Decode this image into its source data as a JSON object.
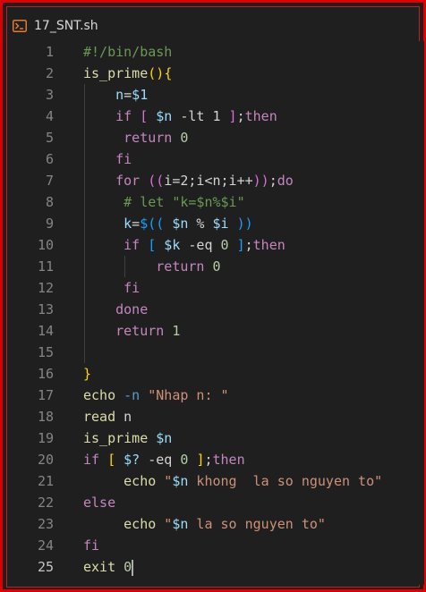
{
  "tab": {
    "icon": "terminal-icon",
    "title": "17_SNT.sh"
  },
  "colors": {
    "frame": "#e00000",
    "background": "#1f1f1f",
    "line_number": "#858585",
    "comment": "#6a9955",
    "keyword": "#c586c0",
    "function": "#dcdcaa",
    "variable": "#9cdcfe",
    "string": "#ce9178",
    "number": "#b5cea8"
  },
  "editor": {
    "active_line": 25,
    "lines": [
      {
        "n": "1",
        "indent": 0,
        "tokens": [
          [
            "cm",
            "#!/bin/bash"
          ]
        ]
      },
      {
        "n": "2",
        "indent": 0,
        "tokens": [
          [
            "fn",
            "is_prime"
          ],
          [
            "b1",
            "()"
          ],
          [
            "b1",
            "{"
          ]
        ]
      },
      {
        "n": "3",
        "indent": 4,
        "tokens": [
          [
            "va",
            "n"
          ],
          [
            "op",
            "="
          ],
          [
            "va",
            "$1"
          ]
        ]
      },
      {
        "n": "4",
        "indent": 4,
        "tokens": [
          [
            "kw",
            "if"
          ],
          [
            "tx",
            " "
          ],
          [
            "b2",
            "["
          ],
          [
            "tx",
            " "
          ],
          [
            "va",
            "$n"
          ],
          [
            "tx",
            " -lt 1 "
          ],
          [
            "b2",
            "]"
          ],
          [
            "tx",
            ";"
          ],
          [
            "kw",
            "then"
          ]
        ]
      },
      {
        "n": "5",
        "indent": 5,
        "tokens": [
          [
            "kw",
            "return"
          ],
          [
            "tx",
            " "
          ],
          [
            "nm",
            "0"
          ]
        ]
      },
      {
        "n": "6",
        "indent": 4,
        "tokens": [
          [
            "kw",
            "fi"
          ]
        ]
      },
      {
        "n": "7",
        "indent": 4,
        "tokens": [
          [
            "kw",
            "for"
          ],
          [
            "tx",
            " "
          ],
          [
            "b2",
            "(("
          ],
          [
            "tx",
            "i=2;i<n;i++"
          ],
          [
            "b2",
            "))"
          ],
          [
            "tx",
            ";"
          ],
          [
            "kw",
            "do"
          ]
        ]
      },
      {
        "n": "8",
        "indent": 5,
        "tokens": [
          [
            "cm",
            "# let \"k=$n%$i\""
          ]
        ]
      },
      {
        "n": "9",
        "indent": 5,
        "tokens": [
          [
            "va",
            "k"
          ],
          [
            "op",
            "="
          ],
          [
            "b3",
            "$(("
          ],
          [
            "tx",
            " "
          ],
          [
            "va",
            "$n"
          ],
          [
            "tx",
            " % "
          ],
          [
            "va",
            "$i"
          ],
          [
            "tx",
            " "
          ],
          [
            "b3",
            "))"
          ]
        ]
      },
      {
        "n": "10",
        "indent": 5,
        "tokens": [
          [
            "kw",
            "if"
          ],
          [
            "tx",
            " "
          ],
          [
            "b3",
            "["
          ],
          [
            "tx",
            " "
          ],
          [
            "va",
            "$k"
          ],
          [
            "tx",
            " -eq "
          ],
          [
            "nm",
            "0"
          ],
          [
            "tx",
            " "
          ],
          [
            "b3",
            "]"
          ],
          [
            "tx",
            ";"
          ],
          [
            "kw",
            "then"
          ]
        ]
      },
      {
        "n": "11",
        "indent": 9,
        "tokens": [
          [
            "kw",
            "return"
          ],
          [
            "tx",
            " "
          ],
          [
            "nm",
            "0"
          ]
        ]
      },
      {
        "n": "12",
        "indent": 5,
        "tokens": [
          [
            "kw",
            "fi"
          ]
        ]
      },
      {
        "n": "13",
        "indent": 4,
        "tokens": [
          [
            "kw",
            "done"
          ]
        ]
      },
      {
        "n": "14",
        "indent": 4,
        "tokens": [
          [
            "kw",
            "return"
          ],
          [
            "tx",
            " "
          ],
          [
            "nm",
            "1"
          ]
        ]
      },
      {
        "n": "15",
        "indent": 0,
        "tokens": []
      },
      {
        "n": "16",
        "indent": 0,
        "tokens": [
          [
            "b1",
            "}"
          ]
        ]
      },
      {
        "n": "17",
        "indent": 0,
        "tokens": [
          [
            "fn",
            "echo"
          ],
          [
            "tx",
            " "
          ],
          [
            "fl",
            "-n"
          ],
          [
            "tx",
            " "
          ],
          [
            "st",
            "\"Nhap n: \""
          ]
        ]
      },
      {
        "n": "18",
        "indent": 0,
        "tokens": [
          [
            "fn",
            "read"
          ],
          [
            "tx",
            " "
          ],
          [
            "tx",
            "n"
          ]
        ]
      },
      {
        "n": "19",
        "indent": 0,
        "tokens": [
          [
            "fn",
            "is_prime"
          ],
          [
            "tx",
            " "
          ],
          [
            "va",
            "$n"
          ]
        ]
      },
      {
        "n": "20",
        "indent": 0,
        "tokens": [
          [
            "kw",
            "if"
          ],
          [
            "tx",
            " "
          ],
          [
            "b1",
            "["
          ],
          [
            "tx",
            " "
          ],
          [
            "va",
            "$?"
          ],
          [
            "tx",
            " -eq "
          ],
          [
            "nm",
            "0"
          ],
          [
            "tx",
            " "
          ],
          [
            "b1",
            "]"
          ],
          [
            "tx",
            ";"
          ],
          [
            "kw",
            "then"
          ]
        ]
      },
      {
        "n": "21",
        "indent": 5,
        "tokens": [
          [
            "fn",
            "echo"
          ],
          [
            "tx",
            " "
          ],
          [
            "st",
            "\""
          ],
          [
            "va",
            "$n"
          ],
          [
            "st",
            " khong  la so nguyen to\""
          ]
        ]
      },
      {
        "n": "22",
        "indent": 0,
        "tokens": [
          [
            "kw",
            "else"
          ]
        ]
      },
      {
        "n": "23",
        "indent": 5,
        "tokens": [
          [
            "fn",
            "echo"
          ],
          [
            "tx",
            " "
          ],
          [
            "st",
            "\""
          ],
          [
            "va",
            "$n"
          ],
          [
            "st",
            " la so nguyen to\""
          ]
        ]
      },
      {
        "n": "24",
        "indent": 0,
        "tokens": [
          [
            "kw",
            "fi"
          ]
        ]
      },
      {
        "n": "25",
        "indent": 0,
        "tokens": [
          [
            "fn",
            "exit"
          ],
          [
            "tx",
            " "
          ],
          [
            "nm",
            "0"
          ]
        ]
      }
    ]
  }
}
